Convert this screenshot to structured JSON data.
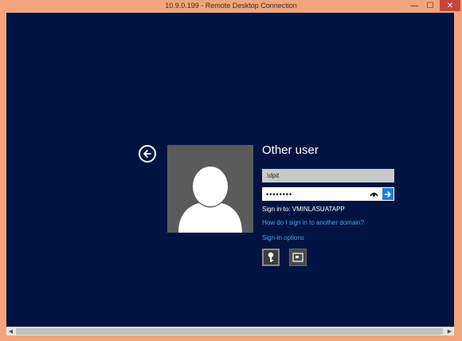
{
  "window": {
    "title": "10.9.0.199 - Remote Desktop Connection",
    "minimize_glyph": "—",
    "maximize_glyph": "☐",
    "close_glyph": "✕",
    "frame_color": "#f2a57d",
    "close_color": "#c7463a"
  },
  "logon": {
    "background_color": "#011441",
    "accent_color": "#1f7ed9",
    "link_color": "#4aa3f0",
    "back_icon": "back-arrow-icon",
    "user_tile_icon": "default-user-avatar",
    "heading": "Other user",
    "username_value": ".\\dpit",
    "password_value": "••••••••",
    "reveal_icon": "eye-icon",
    "submit_icon": "arrow-right-icon",
    "sign_in_to": "Sign in to: VMINLASUATAPP",
    "domain_help_link": "How do I sign in to another domain?",
    "sign_in_options_link": "Sign-in options",
    "options": [
      {
        "name": "password",
        "icon": "key-icon",
        "selected": true
      },
      {
        "name": "smart-card",
        "icon": "smart-card-icon",
        "selected": false
      }
    ]
  },
  "scrollbar": {
    "left_glyph": "◀",
    "right_glyph": "▶"
  }
}
